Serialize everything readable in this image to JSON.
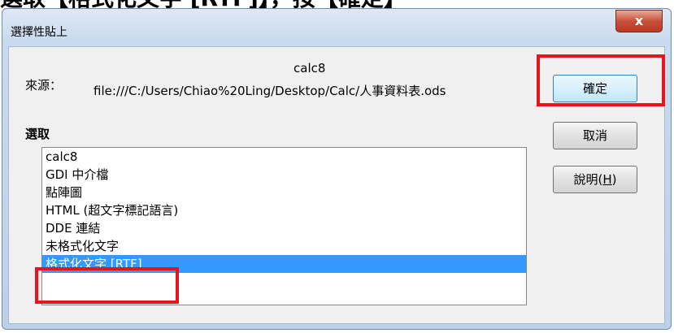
{
  "top_text": "選取【格式化文字 [RTF]】，按【確定】",
  "dialog": {
    "title": "選擇性貼上",
    "close_glyph": "x",
    "source_label": "來源：",
    "source_name": "calc8",
    "source_path": "file:///C:/Users/Chiao%20Ling/Desktop/Calc/人事資料表.ods",
    "select_label": "選取",
    "list_items": [
      "calc8",
      "GDI 中介檔",
      "點陣圖",
      "HTML (超文字標記語言)",
      "DDE 連結",
      "未格式化文字",
      "格式化文字 [RTF]"
    ],
    "selected_index": 6,
    "buttons": {
      "ok": "確定",
      "cancel": "取消",
      "help_prefix": "說明(",
      "help_key": "H",
      "help_suffix": ")"
    }
  },
  "colors": {
    "highlight": "#e8141b",
    "selection": "#3399ff"
  }
}
